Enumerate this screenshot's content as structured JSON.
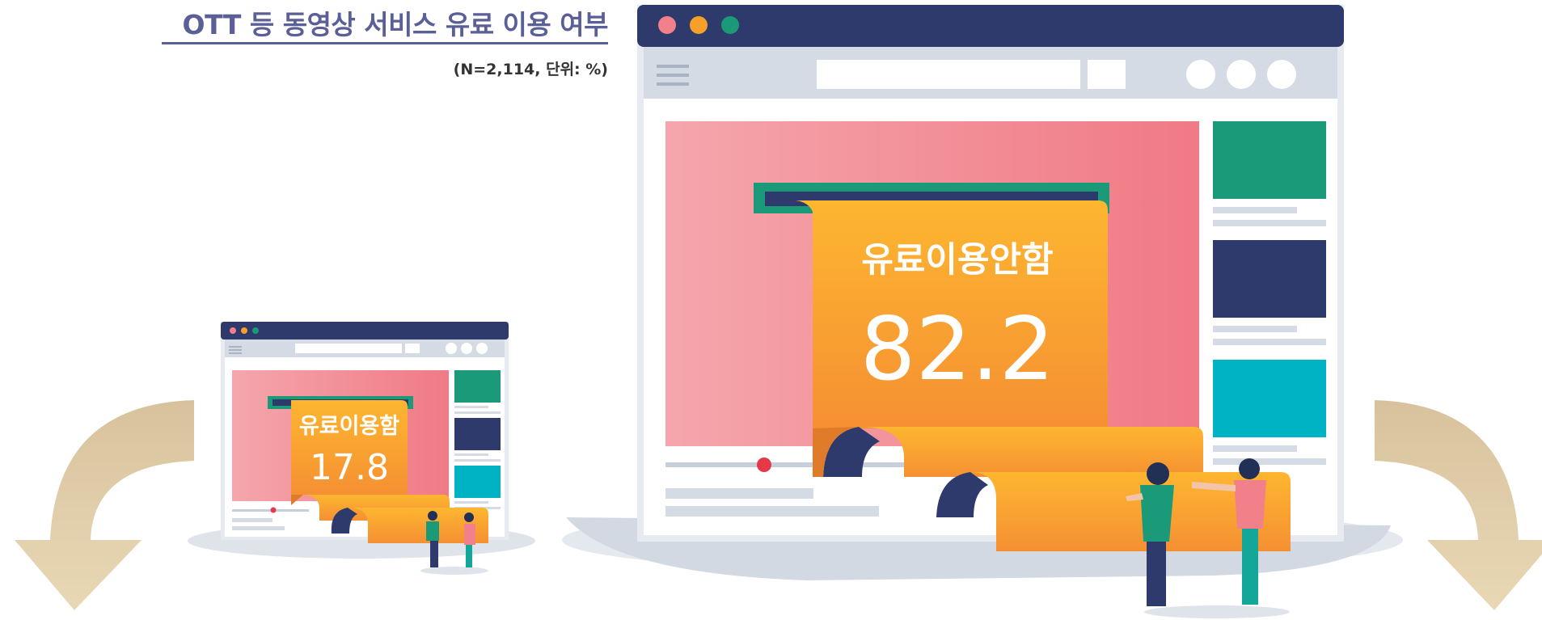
{
  "chart_data": {
    "type": "pictorial",
    "title": "OTT 등 동영상 서비스 유료 이용 여부",
    "subtitle": "(N=2,114, 단위: %)",
    "categories": [
      "유료이용함",
      "유료이용안함"
    ],
    "values": [
      17.8,
      82.2
    ]
  },
  "colors": {
    "title": "#5b5f97",
    "scroll_orange": "#f6a02b",
    "browser_navy": "#2e3a6b",
    "video_pink": "#f2808b",
    "arrow_gold": "#d9c29a"
  }
}
